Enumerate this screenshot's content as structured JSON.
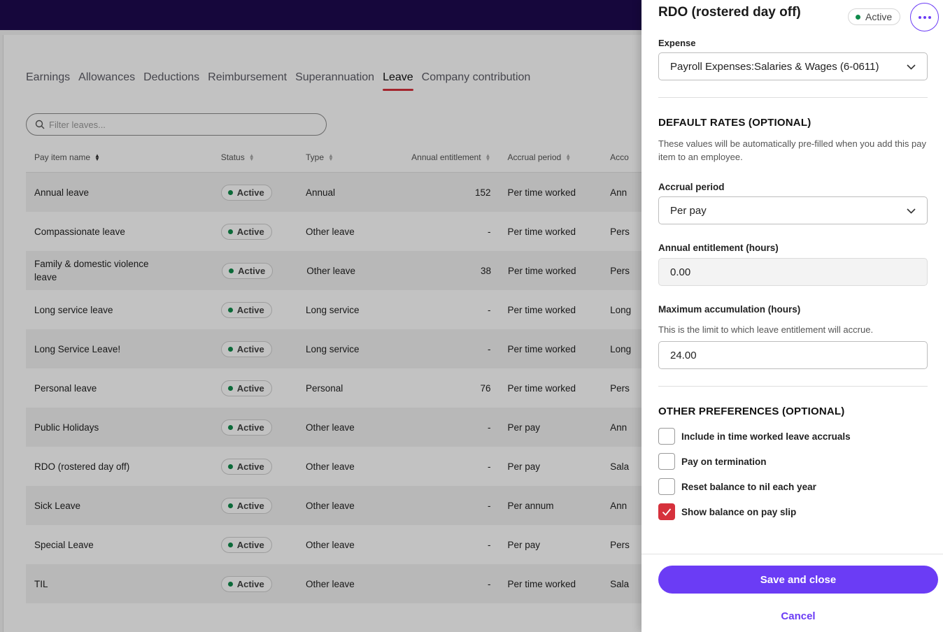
{
  "tabs": [
    "Earnings",
    "Allowances",
    "Deductions",
    "Reimbursement",
    "Superannuation",
    "Leave",
    "Company contribution"
  ],
  "active_tab": "Leave",
  "filter": {
    "placeholder": "Filter leaves..."
  },
  "table": {
    "headers": {
      "name": "Pay item name",
      "status": "Status",
      "type": "Type",
      "entitlement": "Annual entitlement",
      "accrual": "Accrual period",
      "acc2": "Acco"
    },
    "rows": [
      {
        "name": "Annual leave",
        "status": "Active",
        "type": "Annual",
        "entitlement": "152",
        "accrual": "Per time worked",
        "acc2": "Ann"
      },
      {
        "name": "Compassionate leave",
        "status": "Active",
        "type": "Other leave",
        "entitlement": "-",
        "accrual": "Per time worked",
        "acc2": "Pers"
      },
      {
        "name": "Family & domestic violence leave",
        "status": "Active",
        "type": "Other leave",
        "entitlement": "38",
        "accrual": "Per time worked",
        "acc2": "Pers"
      },
      {
        "name": "Long service leave",
        "status": "Active",
        "type": "Long service",
        "entitlement": "-",
        "accrual": "Per time worked",
        "acc2": "Long"
      },
      {
        "name": "Long Service Leave!",
        "status": "Active",
        "type": "Long service",
        "entitlement": "-",
        "accrual": "Per time worked",
        "acc2": "Long"
      },
      {
        "name": "Personal leave",
        "status": "Active",
        "type": "Personal",
        "entitlement": "76",
        "accrual": "Per time worked",
        "acc2": "Pers"
      },
      {
        "name": "Public Holidays",
        "status": "Active",
        "type": "Other leave",
        "entitlement": "-",
        "accrual": "Per pay",
        "acc2": "Ann"
      },
      {
        "name": "RDO (rostered day off)",
        "status": "Active",
        "type": "Other leave",
        "entitlement": "-",
        "accrual": "Per pay",
        "acc2": "Sala"
      },
      {
        "name": "Sick Leave",
        "status": "Active",
        "type": "Other leave",
        "entitlement": "-",
        "accrual": "Per annum",
        "acc2": "Ann"
      },
      {
        "name": "Special Leave",
        "status": "Active",
        "type": "Other leave",
        "entitlement": "-",
        "accrual": "Per pay",
        "acc2": "Pers"
      },
      {
        "name": "TIL",
        "status": "Active",
        "type": "Other leave",
        "entitlement": "-",
        "accrual": "Per time worked",
        "acc2": "Sala"
      }
    ]
  },
  "panel": {
    "title": "RDO (rostered day off)",
    "status": "Active",
    "expense_label": "Expense",
    "expense_value": "Payroll Expenses:Salaries & Wages (6-0611)",
    "default_rates_title": "DEFAULT RATES (OPTIONAL)",
    "default_rates_help": "These values will be automatically pre-filled when you add this pay item to an employee.",
    "accrual_label": "Accrual period",
    "accrual_value": "Per pay",
    "entitlement_label": "Annual entitlement (hours)",
    "entitlement_value": "0.00",
    "max_label": "Maximum accumulation (hours)",
    "max_help": "This is the limit to which leave entitlement will accrue.",
    "max_value": "24.00",
    "prefs_title": "OTHER PREFERENCES (OPTIONAL)",
    "prefs": [
      {
        "label": "Include in time worked leave accruals",
        "checked": false
      },
      {
        "label": "Pay on termination",
        "checked": false
      },
      {
        "label": "Reset balance to nil each year",
        "checked": false
      },
      {
        "label": "Show balance on pay slip",
        "checked": true
      }
    ],
    "save_label": "Save and close",
    "cancel_label": "Cancel"
  },
  "colors": {
    "topbar": "#1d0a50",
    "accent": "#6b3cf5",
    "tab_underline": "#d6313c",
    "status_dot": "#0f8a4a",
    "checkbox_on": "#d6313c"
  }
}
